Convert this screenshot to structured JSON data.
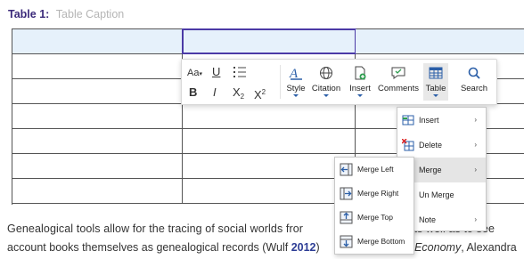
{
  "caption": {
    "label": "Table 1:",
    "placeholder": "Table Caption"
  },
  "table": {
    "rows": 7,
    "cols": 3
  },
  "body_text": {
    "line1": "Genealogical tools allow for the tracing of social worlds fror",
    "line1_tail": "ks, as well as to see",
    "line2_prefix": "account books themselves as genealogical records (Wulf ",
    "line2_year": "2012",
    "line2_close": ")",
    "line2_tail_italic": "e Economy",
    "line2_tail": ", Alexandra"
  },
  "toolbar": {
    "format": {
      "font_size": "Aa",
      "underline": "U",
      "list": "list-icon",
      "bold": "B",
      "italic": "I",
      "subscript": "X",
      "sub_mark": "2",
      "superscript": "X",
      "sup_mark": "2"
    },
    "tools": [
      {
        "label": "Style",
        "icon": "style-icon"
      },
      {
        "label": "Citation",
        "icon": "globe-icon"
      },
      {
        "label": "Insert",
        "icon": "insert-doc-icon"
      },
      {
        "label": "Comments",
        "icon": "comment-icon"
      },
      {
        "label": "Table",
        "icon": "table-icon"
      },
      {
        "label": "Search",
        "icon": "search-icon"
      }
    ]
  },
  "table_menu": [
    {
      "label": "Insert",
      "icon": "table-insert-icon",
      "arrow": "›"
    },
    {
      "label": "Delete",
      "icon": "table-delete-icon",
      "arrow": "›"
    },
    {
      "label": "Merge",
      "icon": "",
      "arrow": "›"
    },
    {
      "label": "Un Merge",
      "icon": "",
      "arrow": ""
    },
    {
      "label": "Note",
      "icon": "",
      "arrow": "›"
    }
  ],
  "merge_menu": [
    {
      "label": "Merge Left",
      "icon": "merge-left-icon"
    },
    {
      "label": "Merge Right",
      "icon": "merge-right-icon"
    },
    {
      "label": "Merge Top",
      "icon": "merge-top-icon"
    },
    {
      "label": "Merge Bottom",
      "icon": "merge-bottom-icon"
    }
  ],
  "colors": {
    "accent": "#4b3aa6",
    "header_fill": "#e6f1fb",
    "icon_blue": "#2b5fa8"
  }
}
